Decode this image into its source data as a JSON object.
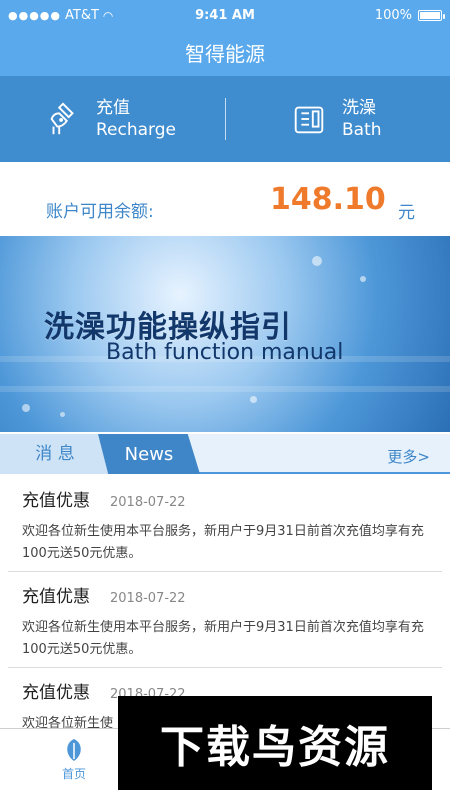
{
  "status_bar": {
    "carrier": "AT&T",
    "time": "9:41 AM",
    "battery": "100%"
  },
  "header": {
    "title": "智得能源"
  },
  "actions": {
    "recharge": {
      "label_cn": "充值",
      "label_en": "Recharge",
      "icon": "recharge-icon"
    },
    "bath": {
      "label_cn": "洗澡",
      "label_en": "Bath",
      "icon": "bath-icon"
    }
  },
  "balance": {
    "label": "账户可用余额:",
    "amount": "148.10",
    "unit": "元"
  },
  "banner": {
    "title_cn": "洗澡功能操纵指引",
    "title_en": "Bath function manual"
  },
  "news_tabs": {
    "messages": "消 息",
    "news": "News",
    "more": "更多>"
  },
  "news_items": [
    {
      "title": "充值优惠",
      "date": "2018-07-22",
      "body": "欢迎各位新生使用本平台服务，新用户于9月31日前首次充值均享有充100元送50元优惠。"
    },
    {
      "title": "充值优惠",
      "date": "2018-07-22",
      "body": "欢迎各位新生使用本平台服务，新用户于9月31日前首次充值均享有充100元送50元优惠。"
    },
    {
      "title": "充值优惠",
      "date": "2018-07-22",
      "body": "欢迎各位新生使"
    }
  ],
  "bottom_nav": {
    "home": "首页"
  },
  "watermark": {
    "text": "下载鸟资源"
  },
  "colors": {
    "header": "#5aa9ec",
    "action_bar": "#3f8ccf",
    "accent_orange": "#ef7a2c",
    "text_blue": "#3d86c9"
  }
}
